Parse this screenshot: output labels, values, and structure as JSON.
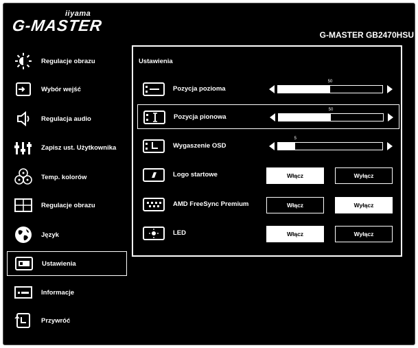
{
  "brand": {
    "small": "iiyama",
    "logo": "G-MASTER",
    "model": "G-MASTER GB2470HSU"
  },
  "sidebar": {
    "items": [
      {
        "label": "Regulacje obrazu",
        "icon": "brightness-icon"
      },
      {
        "label": "Wybór wejść",
        "icon": "input-icon"
      },
      {
        "label": "Regulacja audio",
        "icon": "speaker-icon"
      },
      {
        "label": "Zapisz ust. Użytkownika",
        "icon": "user-settings-icon"
      },
      {
        "label": "Temp. kolorów",
        "icon": "color-temp-icon"
      },
      {
        "label": "Regulacje obrazu",
        "icon": "image-adjust-icon"
      },
      {
        "label": "Język",
        "icon": "globe-icon"
      },
      {
        "label": "Ustawienia",
        "icon": "settings-icon"
      },
      {
        "label": "Informacje",
        "icon": "info-icon"
      },
      {
        "label": "Przywróć",
        "icon": "reset-icon"
      }
    ],
    "active_index": 7
  },
  "panel": {
    "title": "Ustawienia",
    "rows": [
      {
        "label": "Pozycja pozioma",
        "type": "slider",
        "value": 50,
        "max": 100,
        "icon": "horizontal-position-icon"
      },
      {
        "label": "Pozycja pionowa",
        "type": "slider",
        "value": 50,
        "max": 100,
        "icon": "vertical-position-icon"
      },
      {
        "label": "Wygaszenie OSD",
        "type": "slider",
        "value": 5,
        "max": 30,
        "icon": "osd-timeout-icon"
      },
      {
        "label": "Logo startowe",
        "type": "toggle",
        "on": "Włącz",
        "off": "Wyłącz",
        "selected": "on",
        "icon": "logo-icon"
      },
      {
        "label": "AMD FreeSync Premium",
        "type": "toggle",
        "on": "Włącz",
        "off": "Wyłącz",
        "selected": "off",
        "icon": "freesync-icon"
      },
      {
        "label": "LED",
        "type": "toggle",
        "on": "Włącz",
        "off": "Wyłącz",
        "selected": "on",
        "icon": "led-icon"
      }
    ],
    "highlighted_index": 1
  }
}
